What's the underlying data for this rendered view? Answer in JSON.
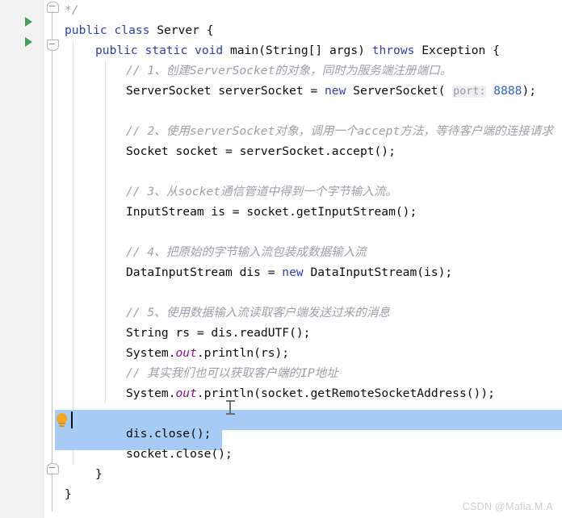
{
  "app": {
    "kind": "java-code-editor",
    "watermark": "CSDN @Mafia.M.A"
  },
  "colors": {
    "keyword": "#2b3fb5",
    "number": "#2b60d6",
    "comment": "#9ba0a8",
    "field": "#871094",
    "selection": "#a6ccf5",
    "gutter_bg": "#f2f2f2",
    "run_arrow": "#499c5b",
    "bulb": "#f5a623",
    "editor_bg": "#ffffff"
  },
  "gutter": {
    "run_arrows": [
      "run-class-arrow",
      "run-main-method-arrow"
    ],
    "fold_markers": [
      "fold-comment-end",
      "fold-method-start",
      "fold-method-end"
    ]
  },
  "intention": {
    "bulb_label": "lightbulb-intention-action"
  },
  "code": {
    "lines": [
      {
        "id": "l1",
        "indent": 0,
        "tokens": [
          {
            "t": "cmt",
            "v": "*/"
          }
        ]
      },
      {
        "id": "l2",
        "indent": 0,
        "tokens": [
          {
            "t": "kw",
            "v": "public"
          },
          {
            "t": "plain",
            "v": " "
          },
          {
            "t": "kw",
            "v": "class"
          },
          {
            "t": "plain",
            "v": " Server {"
          }
        ]
      },
      {
        "id": "l3",
        "indent": 1,
        "tokens": [
          {
            "t": "kw",
            "v": "public"
          },
          {
            "t": "plain",
            "v": " "
          },
          {
            "t": "kw",
            "v": "static"
          },
          {
            "t": "plain",
            "v": " "
          },
          {
            "t": "kw",
            "v": "void"
          },
          {
            "t": "plain",
            "v": " main(String[] args) "
          },
          {
            "t": "kw",
            "v": "throws"
          },
          {
            "t": "plain",
            "v": " Exception {"
          }
        ]
      },
      {
        "id": "l4",
        "indent": 2,
        "tokens": [
          {
            "t": "cmt",
            "v": "// 1、创建ServerSocket的对象，同时为服务端注册端口。"
          }
        ]
      },
      {
        "id": "l5",
        "indent": 2,
        "tokens": [
          {
            "t": "plain",
            "v": "ServerSocket serverSocket = "
          },
          {
            "t": "kw",
            "v": "new"
          },
          {
            "t": "plain",
            "v": " ServerSocket( "
          },
          {
            "t": "hint",
            "v": "port:"
          },
          {
            "t": "plain",
            "v": " "
          },
          {
            "t": "num",
            "v": "8888"
          },
          {
            "t": "plain",
            "v": ");"
          }
        ]
      },
      {
        "id": "l6",
        "indent": 0,
        "tokens": []
      },
      {
        "id": "l7",
        "indent": 2,
        "tokens": [
          {
            "t": "cmt",
            "v": "// 2、使用serverSocket对象，调用一个accept方法，等待客户端的连接请求"
          }
        ]
      },
      {
        "id": "l8",
        "indent": 2,
        "tokens": [
          {
            "t": "plain",
            "v": "Socket socket = serverSocket.accept();"
          }
        ]
      },
      {
        "id": "l9",
        "indent": 0,
        "tokens": []
      },
      {
        "id": "l10",
        "indent": 2,
        "tokens": [
          {
            "t": "cmt",
            "v": "// 3、从socket通信管道中得到一个字节输入流。"
          }
        ]
      },
      {
        "id": "l11",
        "indent": 2,
        "tokens": [
          {
            "t": "plain",
            "v": "InputStream is = socket.getInputStream();"
          }
        ]
      },
      {
        "id": "l12",
        "indent": 0,
        "tokens": []
      },
      {
        "id": "l13",
        "indent": 2,
        "tokens": [
          {
            "t": "cmt",
            "v": "// 4、把原始的字节输入流包装成数据输入流"
          }
        ]
      },
      {
        "id": "l14",
        "indent": 2,
        "tokens": [
          {
            "t": "plain",
            "v": "DataInputStream dis = "
          },
          {
            "t": "kw",
            "v": "new"
          },
          {
            "t": "plain",
            "v": " DataInputStream(is);"
          }
        ]
      },
      {
        "id": "l15",
        "indent": 0,
        "tokens": []
      },
      {
        "id": "l16",
        "indent": 2,
        "tokens": [
          {
            "t": "cmt",
            "v": "// 5、使用数据输入流读取客户端发送过来的消息"
          }
        ]
      },
      {
        "id": "l17",
        "indent": 2,
        "tokens": [
          {
            "t": "plain",
            "v": "String rs = dis.readUTF();"
          }
        ]
      },
      {
        "id": "l18",
        "indent": 2,
        "tokens": [
          {
            "t": "plain",
            "v": "System."
          },
          {
            "t": "fld",
            "v": "out"
          },
          {
            "t": "plain",
            "v": ".println(rs);"
          }
        ]
      },
      {
        "id": "l19",
        "indent": 2,
        "tokens": [
          {
            "t": "cmt",
            "v": "// 其实我们也可以获取客户端的IP地址"
          }
        ]
      },
      {
        "id": "l20",
        "indent": 2,
        "tokens": [
          {
            "t": "plain",
            "v": "System."
          },
          {
            "t": "fld",
            "v": "out"
          },
          {
            "t": "plain",
            "v": ".println(socket.getRemoteSocketAddress());"
          }
        ]
      },
      {
        "id": "l21",
        "indent": 0,
        "tokens": []
      },
      {
        "id": "l22",
        "indent": 2,
        "tokens": [
          {
            "t": "plain",
            "v": "dis.close();"
          }
        ]
      },
      {
        "id": "l23",
        "indent": 2,
        "tokens": [
          {
            "t": "plain",
            "v": "socket.close();"
          }
        ]
      },
      {
        "id": "l24",
        "indent": 1,
        "tokens": [
          {
            "t": "plain",
            "v": "}"
          }
        ]
      },
      {
        "id": "l25",
        "indent": 0,
        "tokens": [
          {
            "t": "plain",
            "v": "}"
          }
        ]
      }
    ],
    "selected_line_ids": [
      "l22",
      "l23"
    ]
  }
}
